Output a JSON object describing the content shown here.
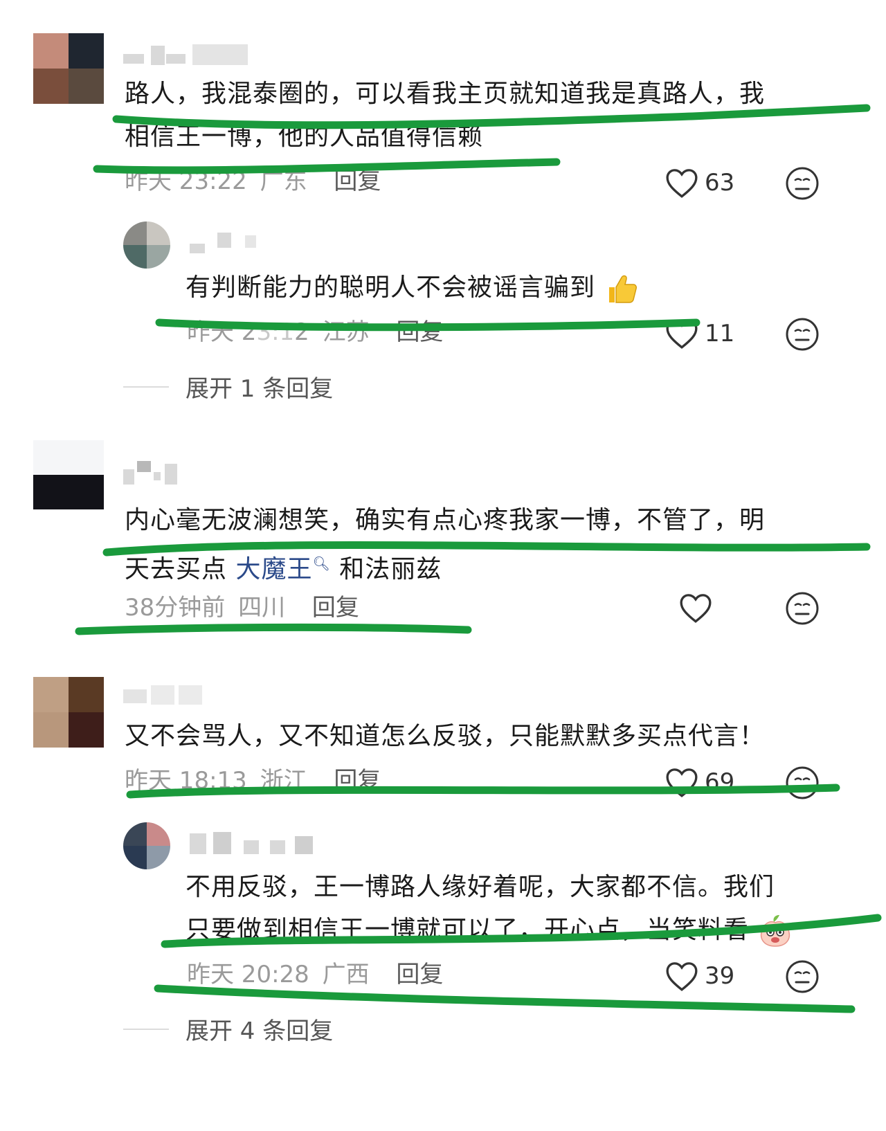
{
  "comments": [
    {
      "text_line1": "路人，我混泰圈的，可以看我主页就知道我是真路人，我",
      "text_line2": "相信王一博，他的人品值得信赖",
      "time": "昨天 23:22",
      "location": "广东",
      "reply_label": "回复",
      "likes": "63",
      "replies": [
        {
          "text": "有判断能力的聪明人不会被谣言骗到",
          "emoji": "thumbs-up",
          "time": "昨天 2",
          "time_blur": "3:1",
          "time_end": "2",
          "location": "江苏",
          "reply_label": "回复",
          "likes": "11"
        }
      ],
      "expand_label": "展开 1 条回复"
    },
    {
      "text_line1": "内心毫无波澜想笑，确实有点心疼我家一博，不管了，明",
      "text_line2_pre": "天去买点 ",
      "text_line2_link": "大魔王",
      "text_line2_post": " 和法丽兹",
      "time": "38分钟前",
      "location": "四川",
      "reply_label": "回复",
      "likes": ""
    },
    {
      "text_line1": "又不会骂人，又不知道怎么反驳，只能默默多买点代言！",
      "time": "昨天 18:13",
      "location": "浙江",
      "reply_label": "回复",
      "likes": "69",
      "replies": [
        {
          "text_line1": "不用反驳，王一博路人缘好着呢，大家都不信。我们",
          "text_line2": "只要做到相信王一博就可以了，开心点，当笑料看",
          "emoji": "peach-laugh",
          "time": "昨天 20:28",
          "location": "广西",
          "reply_label": "回复",
          "likes": "39"
        }
      ],
      "expand_label": "展开 4 条回复"
    }
  ],
  "icons": {
    "like": "heart-outline-icon",
    "emoji": "neutral-face-icon"
  },
  "colors": {
    "highlight": "#1a9a3c",
    "meta": "#9a9a9a",
    "link": "#2b4a8a"
  }
}
